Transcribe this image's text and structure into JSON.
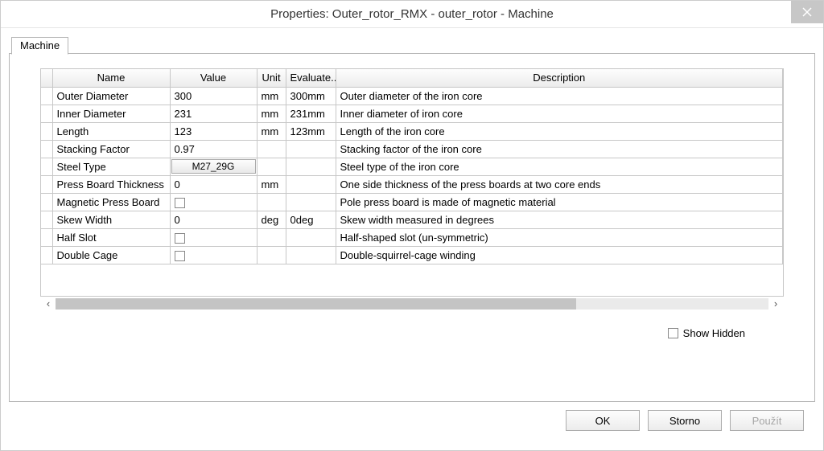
{
  "title": "Properties: Outer_rotor_RMX - outer_rotor - Machine",
  "tab_label": "Machine",
  "columns": {
    "name": "Name",
    "value": "Value",
    "unit": "Unit",
    "evaluate": "Evaluate...",
    "description": "Description"
  },
  "rows": [
    {
      "name": "Outer Diameter",
      "value": "300",
      "type": "text",
      "unit": "mm",
      "eval": "300mm",
      "desc": "Outer diameter of the iron core"
    },
    {
      "name": "Inner Diameter",
      "value": "231",
      "type": "text",
      "unit": "mm",
      "eval": "231mm",
      "desc": "Inner diameter of iron core"
    },
    {
      "name": "Length",
      "value": "123",
      "type": "text",
      "unit": "mm",
      "eval": "123mm",
      "desc": "Length of the iron core"
    },
    {
      "name": "Stacking Factor",
      "value": "0.97",
      "type": "text",
      "unit": "",
      "eval": "",
      "desc": "Stacking factor of the iron core"
    },
    {
      "name": "Steel Type",
      "value": "M27_29G",
      "type": "button",
      "unit": "",
      "eval": "",
      "desc": "Steel type of the iron core"
    },
    {
      "name": "Press Board Thickness",
      "value": "0",
      "type": "text",
      "unit": "mm",
      "eval": "",
      "desc": "One side thickness of the press boards at two core ends"
    },
    {
      "name": "Magnetic Press Board",
      "value": "",
      "type": "check",
      "unit": "",
      "eval": "",
      "desc": "Pole press board is made of magnetic material"
    },
    {
      "name": "Skew Width",
      "value": "0",
      "type": "text",
      "unit": "deg",
      "eval": "0deg",
      "desc": "Skew width measured in degrees"
    },
    {
      "name": "Half Slot",
      "value": "",
      "type": "check",
      "unit": "",
      "eval": "",
      "desc": "Half-shaped slot (un-symmetric)"
    },
    {
      "name": "Double Cage",
      "value": "",
      "type": "check",
      "unit": "",
      "eval": "",
      "desc": "Double-squirrel-cage winding"
    }
  ],
  "show_hidden_label": "Show Hidden",
  "buttons": {
    "ok": "OK",
    "cancel": "Storno",
    "apply": "Použít"
  }
}
